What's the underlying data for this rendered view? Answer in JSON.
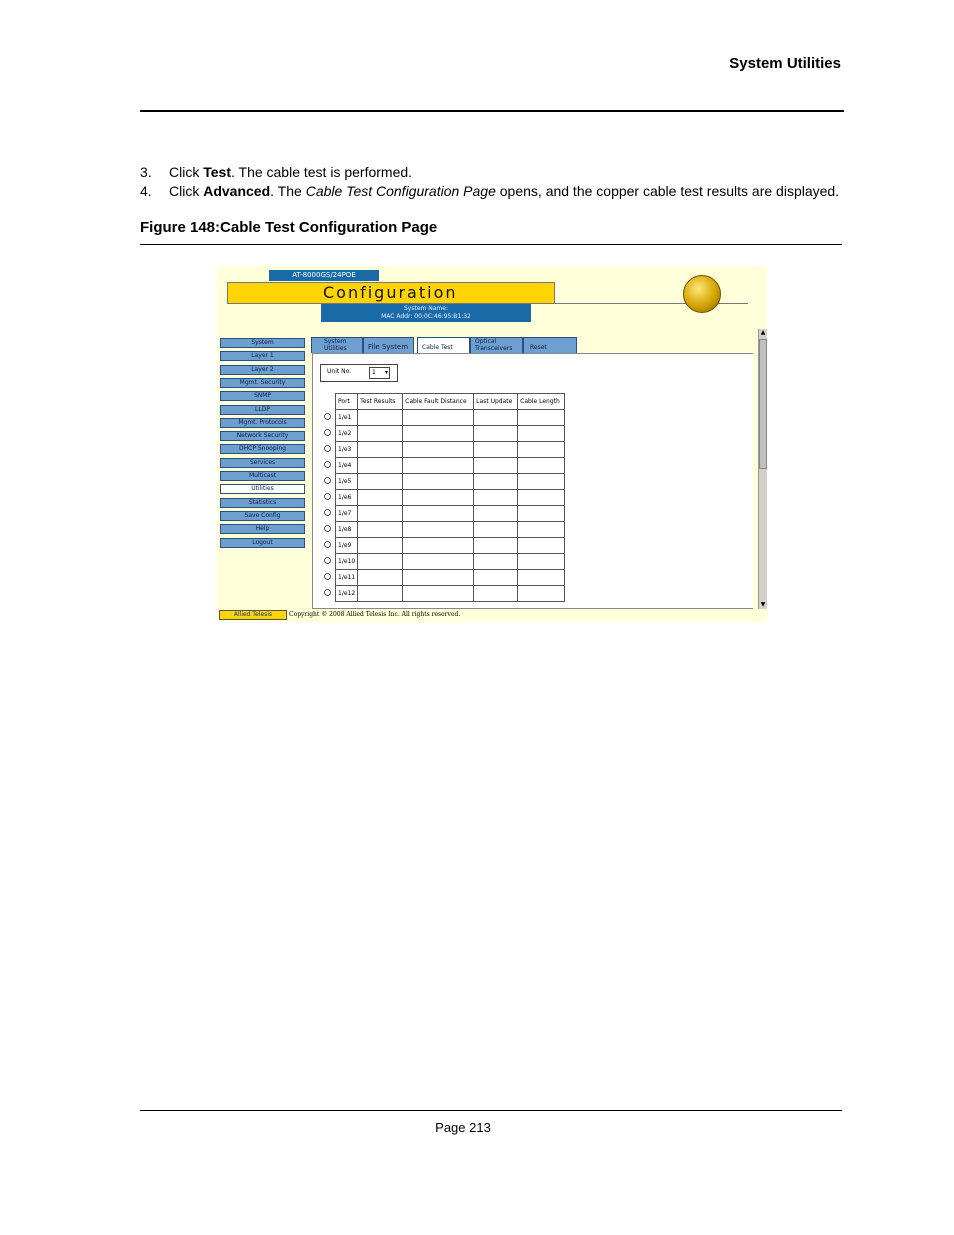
{
  "header": {
    "title": "System Utilities"
  },
  "steps": [
    {
      "num": "3.",
      "pre": "Click ",
      "bold": "Test",
      "post": ". The cable test is performed."
    },
    {
      "num": "4.",
      "pre": "Click ",
      "bold": "Advanced",
      "mid": ". The ",
      "italic": "Cable Test Configuration Page",
      "post": " opens, and the copper cable test results are displayed."
    }
  ],
  "figure": {
    "caption": "Figure 148:Cable Test Configuration Page"
  },
  "screenshot": {
    "model": "AT-8000GS/24POE",
    "title": "Configuration",
    "system_name": "System Name:",
    "mac": "MAC Addr: 00:0C:46:95:B1:32",
    "nav": [
      "System",
      "Layer 1",
      "Layer 2",
      "Mgmt. Security",
      "SNMP",
      "LLDP",
      "Mgmt. Protocols",
      "Network Security",
      "DHCP Snooping",
      "Services",
      "Multicast",
      "Utilities",
      "Statistics",
      "Save Config",
      "Help",
      "Logout"
    ],
    "nav_selected": "Utilities",
    "tabs": [
      "System Utilities",
      "File System",
      "Cable Test",
      "Optical Transceivers",
      "Reset"
    ],
    "tab_selected": "Cable Test",
    "unit_label": "Unit No.",
    "unit_value": "1",
    "columns": [
      "Port",
      "Test Results",
      "Cable Fault Distance",
      "Last Update",
      "Cable Length"
    ],
    "ports": [
      "1/e1",
      "1/e2",
      "1/e3",
      "1/e4",
      "1/e5",
      "1/e6",
      "1/e7",
      "1/e8",
      "1/e9",
      "1/e10",
      "1/e11",
      "1/e12"
    ],
    "brand": "Allied Telesis",
    "copyright": "Copyright © 2008 Allied Telesis Inc. All rights reserved."
  },
  "footer": {
    "page": "Page 213"
  }
}
